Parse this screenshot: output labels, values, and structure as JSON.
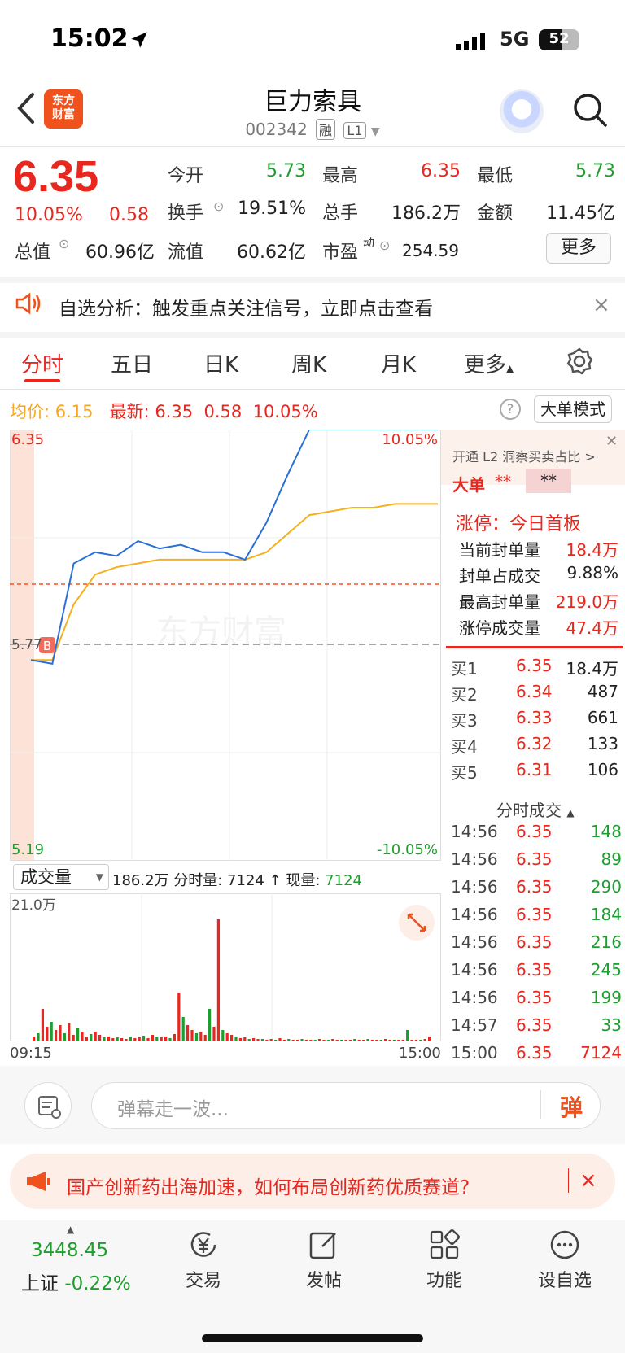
{
  "status": {
    "time": "15:02",
    "network": "5G",
    "battery": "52"
  },
  "header": {
    "logo_line1": "东方",
    "logo_line2": "财富",
    "name": "巨力索具",
    "code": "002342",
    "tag1": "融",
    "tag2": "L1"
  },
  "quote": {
    "price": "6.35",
    "pct": "10.05%",
    "chg": "0.58",
    "open_label": "今开",
    "open": "5.73",
    "high_label": "最高",
    "high": "6.35",
    "low_label": "最低",
    "low": "5.73",
    "turnover_label": "换手",
    "turnover": "19.51%",
    "volume_label": "总手",
    "volume": "186.2万",
    "amount_label": "金额",
    "amount": "11.45亿",
    "mktcap_label": "总值",
    "mktcap": "60.96亿",
    "float_label": "流值",
    "float": "60.62亿",
    "pe_label": "市盈",
    "pe_sup": "动",
    "pe": "254.59",
    "more": "更多"
  },
  "alert": {
    "text": "自选分析：触发重点关注信号，立即点击查看",
    "close": "×"
  },
  "tabs": [
    "分时",
    "五日",
    "日K",
    "周K",
    "月K",
    "更多"
  ],
  "info": {
    "avg_label": "均价:",
    "avg": "6.15",
    "latest_label": "最新:",
    "latest": "6.35",
    "chg": "0.58",
    "pct": "10.05%",
    "mode": "大单模式"
  },
  "chart": {
    "y_top": "6.35",
    "y_mid": "5.77",
    "y_bottom": "5.19",
    "pct_top": "10.05%",
    "pct_bottom": "-10.05%",
    "b_marker": "B",
    "watermark": "东方财富",
    "vol_select": "成交量",
    "vol_info": "186.2万 分时量: 7124 ↑ 现量:",
    "vol_now": "7124",
    "vol_max": "21.0万",
    "t_start": "09:15",
    "t_end": "15:00"
  },
  "chart_data": {
    "type": "line",
    "series": [
      {
        "values": [
          5.73,
          5.72,
          5.99,
          6.02,
          6.01,
          6.05,
          6.03,
          6.04,
          6.02,
          6.02,
          6.0,
          6.1,
          6.23,
          6.35,
          6.35,
          6.35,
          6.35,
          6.35,
          6.35,
          6.35
        ]
      },
      {
        "values": [
          5.73,
          5.73,
          5.88,
          5.96,
          5.98,
          5.99,
          6.0,
          6.0,
          6.0,
          6.0,
          6.0,
          6.02,
          6.07,
          6.12,
          6.13,
          6.14,
          6.14,
          6.15,
          6.15,
          6.15
        ]
      }
    ],
    "ylim": [
      5.19,
      6.35
    ],
    "x_start": "09:15",
    "x_end": "15:00"
  },
  "panel": {
    "promo": "开通 L2 洞察买卖占比 >",
    "big_label": "大单",
    "big_val1": "**",
    "big_val2": "**",
    "limit_title": "涨停：今日首板",
    "rows": [
      {
        "label": "当前封单量",
        "value": "18.4万"
      },
      {
        "label": "封单占成交",
        "value": "9.88%"
      },
      {
        "label": "最高封单量",
        "value": "219.0万"
      },
      {
        "label": "涨停成交量",
        "value": "47.4万"
      }
    ],
    "bids": [
      {
        "label": "买1",
        "price": "6.35",
        "vol": "18.4万"
      },
      {
        "label": "买2",
        "price": "6.34",
        "vol": "487"
      },
      {
        "label": "买3",
        "price": "6.33",
        "vol": "661"
      },
      {
        "label": "买4",
        "price": "6.32",
        "vol": "133"
      },
      {
        "label": "买5",
        "price": "6.31",
        "vol": "106"
      }
    ],
    "ticks_title": "分时成交",
    "ticks": [
      {
        "time": "14:56",
        "price": "6.35",
        "vol": "148"
      },
      {
        "time": "14:56",
        "price": "6.35",
        "vol": "89"
      },
      {
        "time": "14:56",
        "price": "6.35",
        "vol": "290"
      },
      {
        "time": "14:56",
        "price": "6.35",
        "vol": "184"
      },
      {
        "time": "14:56",
        "price": "6.35",
        "vol": "216"
      },
      {
        "time": "14:56",
        "price": "6.35",
        "vol": "245"
      },
      {
        "time": "14:56",
        "price": "6.35",
        "vol": "199"
      },
      {
        "time": "14:57",
        "price": "6.35",
        "vol": "33"
      },
      {
        "time": "15:00",
        "price": "6.35",
        "vol": "7124"
      }
    ]
  },
  "bottom": {
    "danmu_placeholder": "弹幕走一波...",
    "danmu_send": "弹",
    "news": "国产创新药出海加速，如何布局创新药优质赛道?",
    "news_close": "×",
    "index_value": "3448.45",
    "index_name": "上证",
    "index_pct": "-0.22%",
    "tab_trade": "交易",
    "tab_post": "发帖",
    "tab_func": "功能",
    "tab_watch": "设自选"
  },
  "colors": {
    "up": "#e8271f",
    "down": "#1e9e2f",
    "accent": "#f0521e",
    "price_line": "#2a6fd6",
    "avg_line": "#f5b01e"
  }
}
